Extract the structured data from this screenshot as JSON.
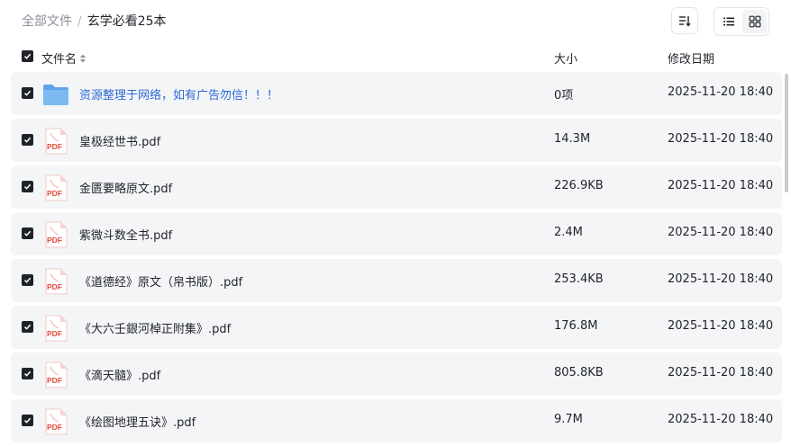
{
  "breadcrumb": {
    "root": "全部文件",
    "separator": "/",
    "current": "玄学必看25本"
  },
  "columns": {
    "name": "文件名",
    "size": "大小",
    "date": "修改日期"
  },
  "files": [
    {
      "name": "资源整理于网络，如有广告勿信！！！",
      "size": "0项",
      "date": "2025-11-20 18:40",
      "type": "folder",
      "icon": "folder-icon"
    },
    {
      "name": "皇极经世书.pdf",
      "size": "14.3M",
      "date": "2025-11-20 18:40",
      "type": "pdf",
      "icon": "pdf-icon",
      "badge": "PDF"
    },
    {
      "name": "金匮要略原文.pdf",
      "size": "226.9KB",
      "date": "2025-11-20 18:40",
      "type": "pdf",
      "icon": "pdf-icon",
      "badge": "PDF"
    },
    {
      "name": "紫微斗数全书.pdf",
      "size": "2.4M",
      "date": "2025-11-20 18:40",
      "type": "pdf",
      "icon": "pdf-icon",
      "badge": "PDF"
    },
    {
      "name": "《道德经》原文（帛书版）.pdf",
      "size": "253.4KB",
      "date": "2025-11-20 18:40",
      "type": "pdf",
      "icon": "pdf-icon",
      "badge": "PDF"
    },
    {
      "name": "《大六壬銀河棹正附集》.pdf",
      "size": "176.8M",
      "date": "2025-11-20 18:40",
      "type": "pdf",
      "icon": "pdf-icon",
      "badge": "PDF"
    },
    {
      "name": "《滴天髓》.pdf",
      "size": "805.8KB",
      "date": "2025-11-20 18:40",
      "type": "pdf",
      "icon": "pdf-icon",
      "badge": "PDF"
    },
    {
      "name": "《绘图地理五诀》.pdf",
      "size": "9.7M",
      "date": "2025-11-20 18:40",
      "type": "pdf",
      "icon": "pdf-icon",
      "badge": "PDF"
    }
  ],
  "colors": {
    "accent": "#2b6bd6",
    "pdf": "#e84b3c",
    "folder": "#6aaef0",
    "row_bg": "#f4f5f7"
  }
}
